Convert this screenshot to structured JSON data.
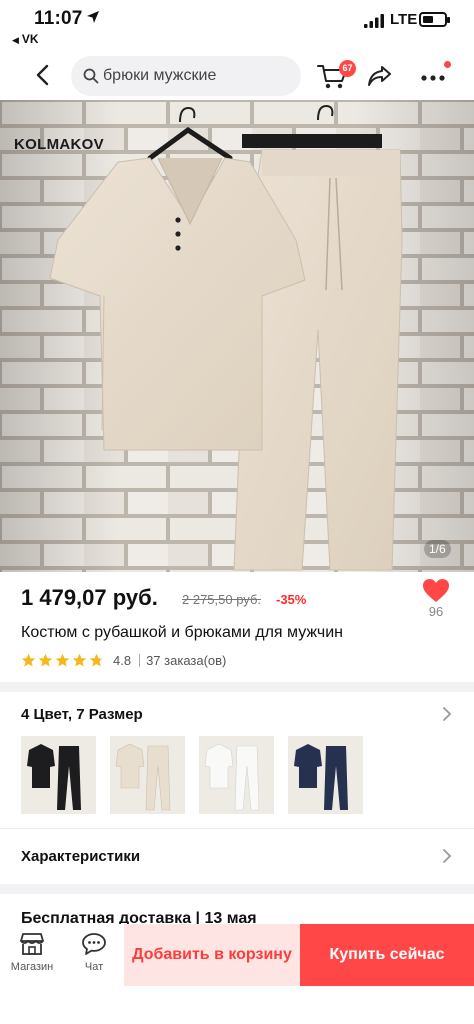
{
  "status_bar": {
    "time": "11:07",
    "back_app": "VK",
    "network": "LTE"
  },
  "header": {
    "search_text": "брюки мужские",
    "cart_count": "67"
  },
  "gallery": {
    "brand": "KOLMAKOV",
    "counter": "1/6"
  },
  "product": {
    "price": "1 479,07 руб.",
    "old_price": "2 275,50 руб.",
    "discount": "-35%",
    "likes": "96",
    "title": "Костюм с рубашкой и брюками для мужчин",
    "rating": "4.8",
    "rating_fraction": 0.96,
    "orders": "37 заказа(ов)"
  },
  "variants": {
    "title": "4 Цвет, 7 Размер",
    "colors": [
      "#1d1d1f",
      "#e8ded0",
      "#f4f4f2",
      "#26314f"
    ]
  },
  "characteristics": {
    "title": "Характеристики"
  },
  "delivery": {
    "text": "Бесплатная доставка | 13 мая"
  },
  "bottom_bar": {
    "shop_label": "Магазин",
    "chat_label": "Чат",
    "add_to_cart": "Добавить в корзину",
    "buy_now": "Купить сейчас"
  },
  "colors": {
    "accent": "#ff4747",
    "cta_light": "#ffe4e4",
    "star": "#f5b81c"
  }
}
